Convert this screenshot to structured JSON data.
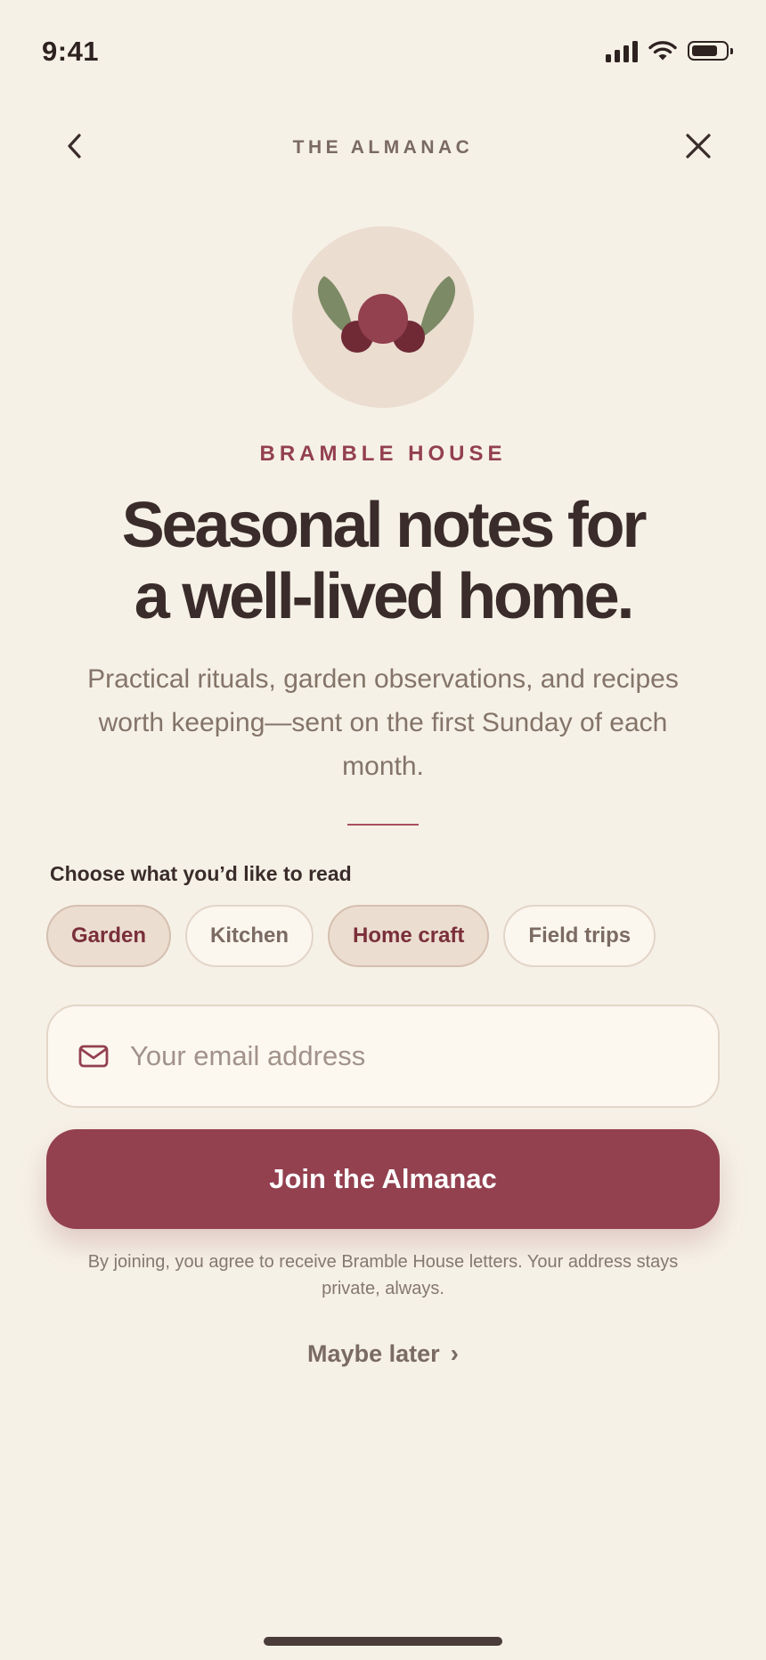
{
  "status_bar": {
    "time": "9:41",
    "icons": [
      "cellular-signal-icon",
      "wifi-icon",
      "battery-icon"
    ],
    "battery_level": 0.8
  },
  "nav": {
    "title": "THE ALMANAC",
    "back_icon": "chevron-left-icon",
    "close_icon": "close-icon"
  },
  "hero": {
    "logo_icon": "berry-leaves-icon",
    "brand": "BRAMBLE HOUSE",
    "headline_line1": "Seasonal notes for",
    "headline_line2": "a well-lived home.",
    "subhead": "Practical rituals, garden observations, and recipes worth keeping—sent on the first Sunday of each month."
  },
  "topics": {
    "label": "Choose what you’d like to read",
    "chips": [
      {
        "label": "Garden",
        "selected": true
      },
      {
        "label": "Kitchen",
        "selected": false
      },
      {
        "label": "Home craft",
        "selected": true
      },
      {
        "label": "Field trips",
        "selected": false
      }
    ]
  },
  "form": {
    "email_icon": "mail-icon",
    "email_placeholder": "Your email address",
    "email_value": "",
    "submit_label": "Join the Almanac",
    "legal": "By joining, you agree to receive Bramble House letters. Your address stays private, always.",
    "secondary_label": "Maybe later",
    "secondary_icon": "chevron-right-icon"
  },
  "colors": {
    "background": "#F6F1E7",
    "accent": "#93404F",
    "leaf": "#7C8A65",
    "chip_selected_bg": "#EBDDD0",
    "text_dark": "#3A2C2A",
    "text_muted": "#847469"
  }
}
